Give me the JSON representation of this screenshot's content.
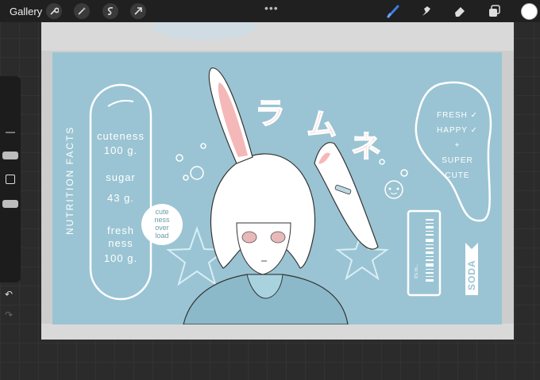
{
  "topbar": {
    "gallery_label": "Gallery",
    "left_tools": [
      "wrench-icon",
      "magic-wand-icon",
      "selection-icon",
      "transform-icon"
    ],
    "more": "•••",
    "right_tools": [
      "brush-icon",
      "smudge-icon",
      "eraser-icon",
      "layers-icon"
    ],
    "active_color": "#ffffff",
    "accent_color": "#3b7fe0"
  },
  "sidebar": {
    "undo": "↶",
    "redo": "↷"
  },
  "artwork": {
    "vertical_label": "NUTRITION FACTS",
    "pill_lines": [
      "cuteness",
      "100 g.",
      "sugar",
      "43 g.",
      "fresh",
      "ness",
      "100 g."
    ],
    "bubble_lines": [
      "cute",
      "ness",
      "over",
      "load"
    ],
    "kana_1": "ラ",
    "kana_2": "ム",
    "kana_3": "ネ",
    "fresh_lines": [
      "FRESH ✓",
      "HAPPY ✓",
      "+",
      "SUPER",
      "CUTE"
    ],
    "barcode_caption": "it's m...",
    "soda_label": "SODA",
    "colors": {
      "label_blue": "#9ac4d3",
      "pink": "#f2a9a4",
      "outline": "#ffffff"
    }
  }
}
